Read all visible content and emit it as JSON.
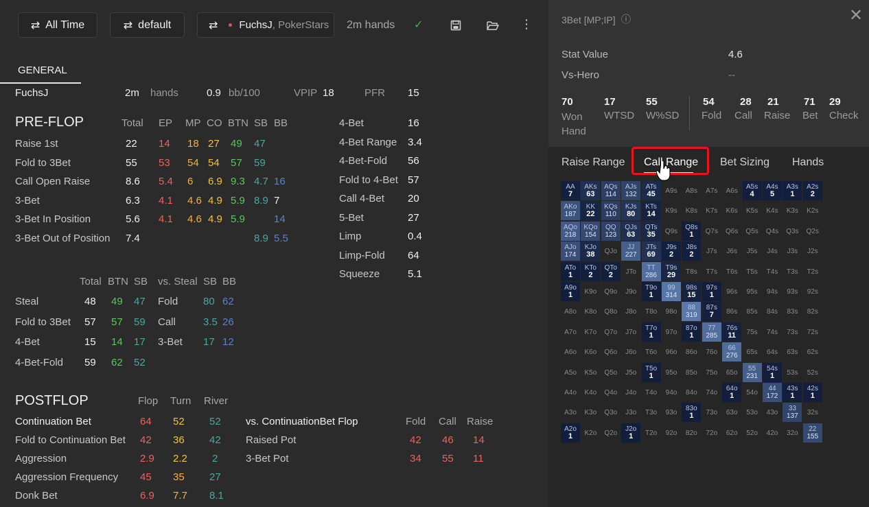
{
  "toolbar": {
    "time_label": "All Time",
    "filter_label": "default",
    "player_name": "FuchsJ",
    "player_site": ", PokerStars",
    "hands_count": "2m hands"
  },
  "tabs": {
    "general": "GENERAL"
  },
  "summary": {
    "player": "FuchsJ",
    "hands_value": "2m",
    "hands_label": "hands",
    "winrate_value": "0.9",
    "winrate_label": "bb/100",
    "vpip_label": "VPIP",
    "vpip_value": "18",
    "pfr_label": "PFR",
    "pfr_value": "15"
  },
  "preflop": {
    "title": "PRE-FLOP",
    "columns": [
      "Total",
      "EP",
      "MP",
      "CO",
      "BTN",
      "SB",
      "BB"
    ],
    "rows": [
      {
        "label": "Raise 1st",
        "values": [
          "22",
          "14",
          "18",
          "27",
          "49",
          "47",
          ""
        ]
      },
      {
        "label": "Fold to 3Bet",
        "values": [
          "55",
          "53",
          "54",
          "54",
          "57",
          "59",
          ""
        ]
      },
      {
        "label": "Call Open Raise",
        "values": [
          "8.6",
          "5.4",
          "6",
          "6.9",
          "9.3",
          "4.7",
          "16"
        ]
      },
      {
        "label": "3-Bet",
        "values": [
          "6.3",
          "4.1",
          "4.6",
          "4.9",
          "5.9",
          "8.9",
          "7"
        ]
      },
      {
        "label": "3-Bet In Position",
        "values": [
          "5.6",
          "4.1",
          "4.6",
          "4.9",
          "5.9",
          "",
          "14"
        ]
      },
      {
        "label": "3-Bet Out of Position",
        "values": [
          "7.4",
          "",
          "",
          "",
          "",
          "8.9",
          "5.5"
        ]
      }
    ],
    "right_stats": [
      {
        "label": "4-Bet",
        "value": "16"
      },
      {
        "label": "4-Bet Range",
        "value": "3.4"
      },
      {
        "label": "4-Bet-Fold",
        "value": "56"
      },
      {
        "label": "Fold to 4-Bet",
        "value": "57"
      },
      {
        "label": "Call 4-Bet",
        "value": "20"
      },
      {
        "label": "5-Bet",
        "value": "27"
      },
      {
        "label": "Limp",
        "value": "0.4"
      },
      {
        "label": "Limp-Fold",
        "value": "64"
      },
      {
        "label": "Squeeze",
        "value": "5.1"
      }
    ]
  },
  "steal": {
    "columns": [
      "Total",
      "BTN",
      "SB"
    ],
    "vs_columns": [
      "vs. Steal",
      "SB",
      "BB"
    ],
    "rows": [
      {
        "label": "Steal",
        "values": [
          "48",
          "49",
          "47"
        ],
        "vs_label": "Fold",
        "vs_values": [
          "80",
          "62"
        ]
      },
      {
        "label": "Fold to 3Bet",
        "values": [
          "57",
          "57",
          "59"
        ],
        "vs_label": "Call",
        "vs_values": [
          "3.5",
          "26"
        ]
      },
      {
        "label": "4-Bet",
        "values": [
          "15",
          "14",
          "17"
        ],
        "vs_label": "3-Bet",
        "vs_values": [
          "17",
          "12"
        ]
      },
      {
        "label": "4-Bet-Fold",
        "values": [
          "59",
          "62",
          "52"
        ],
        "vs_label": "",
        "vs_values": [
          "",
          ""
        ]
      }
    ]
  },
  "postflop": {
    "title": "POSTFLOP",
    "columns": [
      "Flop",
      "Turn",
      "River"
    ],
    "rows": [
      {
        "label": "Continuation Bet",
        "values": [
          "64",
          "52",
          "52"
        ]
      },
      {
        "label": "Fold to Continuation Bet",
        "values": [
          "42",
          "36",
          "42"
        ]
      },
      {
        "label": "Aggression",
        "values": [
          "2.9",
          "2.2",
          "2"
        ]
      },
      {
        "label": "Aggression Frequency",
        "values": [
          "45",
          "35",
          "27"
        ]
      },
      {
        "label": "Donk Bet",
        "values": [
          "6.9",
          "7.7",
          "8.1"
        ]
      }
    ],
    "vs_title": "vs. ContinuationBet Flop",
    "vs_columns": [
      "Fold",
      "Call",
      "Raise"
    ],
    "vs_rows": [
      {
        "label": "Raised Pot",
        "values": [
          "42",
          "46",
          "14"
        ]
      },
      {
        "label": "3-Bet Pot",
        "values": [
          "34",
          "55",
          "11"
        ]
      }
    ]
  },
  "panel": {
    "title": "3Bet [MP;IP]",
    "stat_value_label": "Stat Value",
    "stat_value": "4.6",
    "vs_hero_label": "Vs-Hero",
    "vs_hero_value": "--",
    "summary_left": [
      {
        "value": "70",
        "label": "Won Hand"
      },
      {
        "value": "17",
        "label": "WTSD"
      },
      {
        "value": "55",
        "label": "W%SD"
      }
    ],
    "summary_right": [
      {
        "value": "54",
        "label": "Fold"
      },
      {
        "value": "28",
        "label": "Call"
      },
      {
        "value": "21",
        "label": "Raise"
      },
      {
        "value": "71",
        "label": "Bet"
      },
      {
        "value": "29",
        "label": "Check"
      }
    ],
    "tabs": [
      "Raise Range",
      "Call Range",
      "Bet Sizing",
      "Hands"
    ],
    "active_tab": "Call Range"
  },
  "grid": {
    "ranks": [
      "A",
      "K",
      "Q",
      "J",
      "T",
      "9",
      "8",
      "7",
      "6",
      "5",
      "4",
      "3",
      "2"
    ],
    "cells": {
      "AA": "7",
      "AKs": "63",
      "AQs": "114",
      "AJs": "132",
      "ATs": "45",
      "A5s": "4",
      "A4s": "5",
      "A3s": "1",
      "A2s": "2",
      "AKo": "187",
      "KK": "22",
      "KQs": "110",
      "KJs": "80",
      "KTs": "14",
      "AQo": "218",
      "KQo": "154",
      "QQ": "123",
      "QJs": "63",
      "QTs": "35",
      "Q8s": "1",
      "AJo": "174",
      "KJo": "38",
      "JJ": "227",
      "JTs": "69",
      "J9s": "2",
      "J8s": "2",
      "ATo": "1",
      "KTo": "2",
      "QTo": "2",
      "TT": "286",
      "T9s": "29",
      "A9o": "1",
      "T9o": "1",
      "99": "314",
      "98s": "15",
      "97s": "1",
      "88": "319",
      "87s": "7",
      "T7o": "1",
      "87o": "1",
      "77": "285",
      "76s": "11",
      "66": "276",
      "T5o": "1",
      "55": "231",
      "54s": "1",
      "64o": "1",
      "44": "172",
      "43s": "1",
      "42s": "1",
      "83o": "1",
      "33": "137",
      "A2o": "1",
      "J2o": "1",
      "22": "155"
    }
  }
}
